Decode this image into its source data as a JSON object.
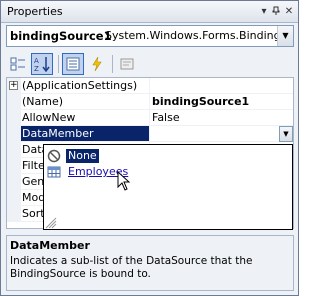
{
  "window": {
    "title": "Properties"
  },
  "object_selector": {
    "name": "bindingSource1",
    "type": "System.Windows.Forms.BindingSource"
  },
  "toolbar": {
    "buttons": [
      {
        "icon": "categorized-icon"
      },
      {
        "icon": "alphabetical-icon",
        "active": true
      },
      {
        "icon": "properties-icon",
        "active": true
      },
      {
        "icon": "events-icon"
      },
      {
        "icon": "property-pages-icon"
      }
    ]
  },
  "grid": {
    "rows": [
      {
        "name": "(ApplicationSettings)",
        "value": "",
        "expandable": true
      },
      {
        "name": "(Name)",
        "value": "bindingSource1",
        "bold": true
      },
      {
        "name": "AllowNew",
        "value": "False"
      },
      {
        "name": "DataMember",
        "value": "",
        "selected": true
      },
      {
        "name": "Data",
        "value": ""
      },
      {
        "name": "Filte",
        "value": ""
      },
      {
        "name": "Gen",
        "value": ""
      },
      {
        "name": "Mod",
        "value": ""
      },
      {
        "name": "Sort",
        "value": ""
      }
    ]
  },
  "dropdown": {
    "items": [
      {
        "label": "None",
        "icon": "none-icon",
        "selected": true
      },
      {
        "label": "Employees",
        "icon": "table-icon",
        "link": true
      }
    ]
  },
  "description": {
    "title": "DataMember",
    "text": "Indicates a sub-list of the DataSource that the BindingSource is bound to."
  },
  "colors": {
    "selection": "#0a246a",
    "link": "#1a0dab",
    "panel": "#eef1f6"
  }
}
